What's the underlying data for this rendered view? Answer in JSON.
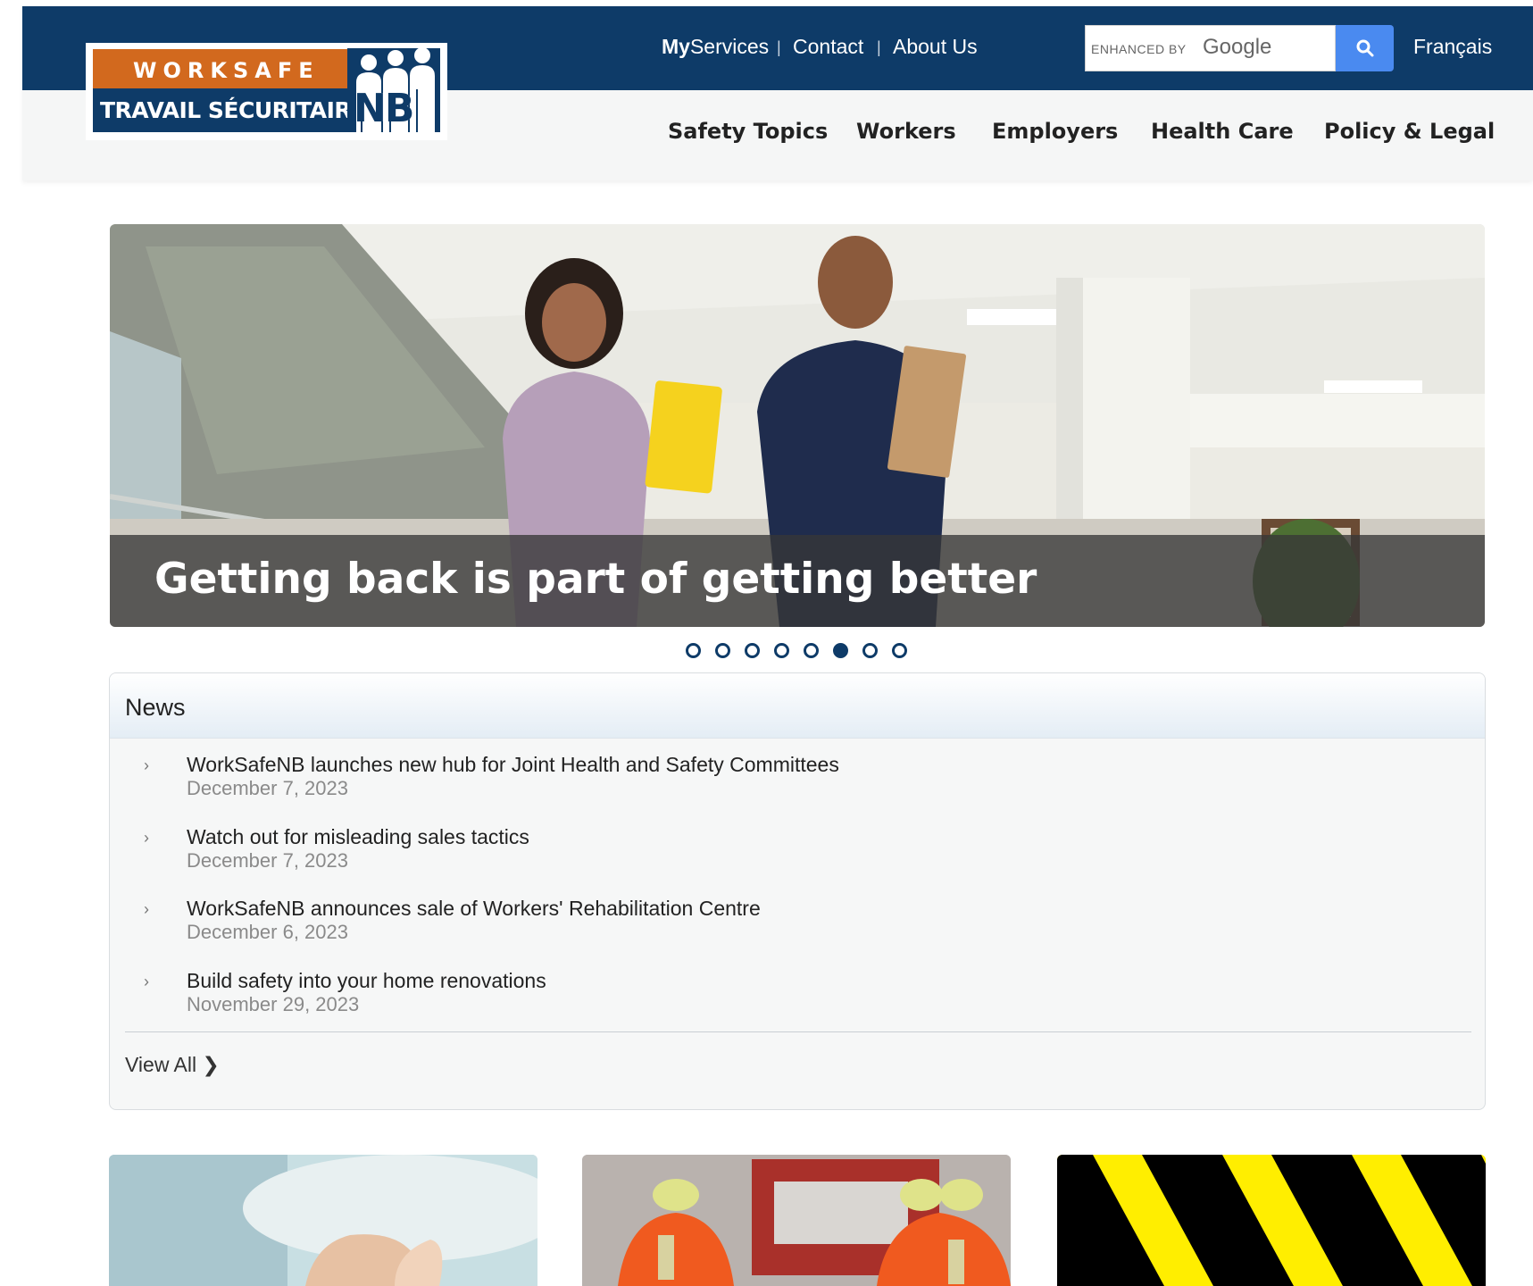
{
  "logo": {
    "top_text": "WORKSAFE",
    "bottom_text": "TRAVAIL SÉCURITAIRE",
    "nb_text": "NB"
  },
  "utility_nav": {
    "myservices_strong": "My",
    "myservices_rest": "Services",
    "contact": "Contact",
    "about": "About Us",
    "separator": "|",
    "language": "Français"
  },
  "search": {
    "enhanced_by": "ENHANCED BY",
    "google": "Google",
    "icon": "search-icon"
  },
  "main_nav": [
    {
      "label": "Safety Topics"
    },
    {
      "label": "Workers"
    },
    {
      "label": "Employers"
    },
    {
      "label": "Health Care"
    },
    {
      "label": "Policy & Legal"
    }
  ],
  "hero": {
    "caption": "Getting back is part of getting better",
    "slide_count": 8,
    "active_slide": 6
  },
  "news": {
    "heading": "News",
    "items": [
      {
        "title": "WorkSafeNB launches new hub for Joint Health and Safety Committees",
        "date": "December 7, 2023"
      },
      {
        "title": "Watch out for misleading sales tactics",
        "date": "December 7, 2023"
      },
      {
        "title": "WorkSafeNB announces sale of Workers' Rehabilitation Centre",
        "date": "December 6, 2023"
      },
      {
        "title": "Build safety into your home renovations",
        "date": "November 29, 2023"
      }
    ],
    "view_all": "View All",
    "chevron_glyph": "›",
    "view_all_glyph": "❯"
  },
  "colors": {
    "brand_navy": "#0e3b68",
    "brand_orange": "#d2691e",
    "search_blue": "#4a8af0",
    "hazard_yellow": "#ffee00"
  }
}
